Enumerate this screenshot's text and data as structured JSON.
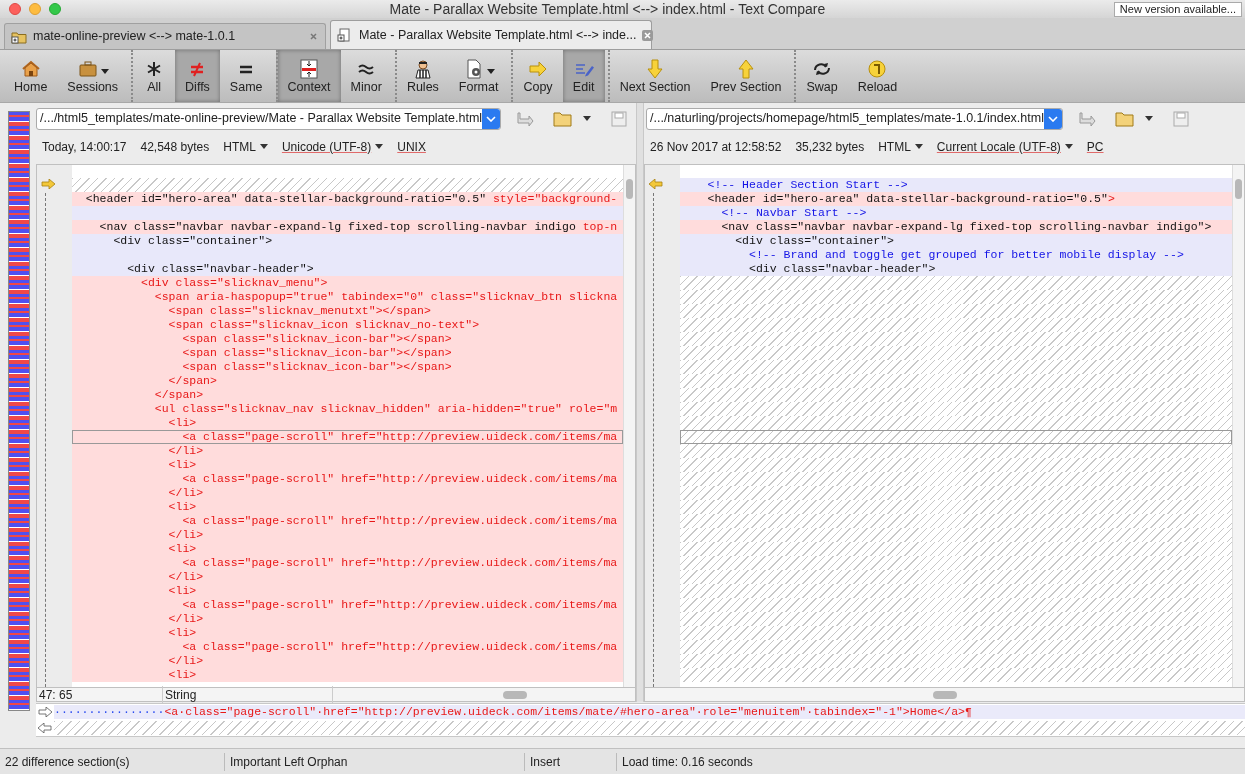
{
  "window": {
    "title": "Mate - Parallax Website Template.html <--> index.html - Text Compare",
    "notice_button": "New version available..."
  },
  "tabs": [
    {
      "label": "mate-online-preview <--> mate-1.0.1",
      "selected": false
    },
    {
      "label": "Mate - Parallax Website Template.html <--> inde...",
      "selected": true
    }
  ],
  "toolbar": [
    {
      "label": "Home",
      "pressed": false,
      "dropdown": false,
      "separator_before": false
    },
    {
      "label": "Sessions",
      "pressed": false,
      "dropdown": true,
      "separator_before": false
    },
    {
      "label": "All",
      "pressed": false,
      "dropdown": false,
      "separator_before": true
    },
    {
      "label": "Diffs",
      "pressed": true,
      "dropdown": false,
      "separator_before": false
    },
    {
      "label": "Same",
      "pressed": false,
      "dropdown": false,
      "separator_before": false
    },
    {
      "label": "Context",
      "pressed": true,
      "dropdown": false,
      "separator_before": true
    },
    {
      "label": "Minor",
      "pressed": false,
      "dropdown": false,
      "separator_before": false
    },
    {
      "label": "Rules",
      "pressed": false,
      "dropdown": false,
      "separator_before": true
    },
    {
      "label": "Format",
      "pressed": false,
      "dropdown": true,
      "separator_before": false
    },
    {
      "label": "Copy",
      "pressed": false,
      "dropdown": false,
      "separator_before": true
    },
    {
      "label": "Edit",
      "pressed": true,
      "dropdown": false,
      "separator_before": false
    },
    {
      "label": "Next Section",
      "pressed": false,
      "dropdown": false,
      "separator_before": true
    },
    {
      "label": "Prev Section",
      "pressed": false,
      "dropdown": false,
      "separator_before": false
    },
    {
      "label": "Swap",
      "pressed": false,
      "dropdown": false,
      "separator_before": true
    },
    {
      "label": "Reload",
      "pressed": false,
      "dropdown": false,
      "separator_before": false
    }
  ],
  "panes": [
    {
      "path": "/.../html5_templates/mate-online-preview/Mate - Parallax Website Template.html",
      "modified": "Today, 14:00:17",
      "size": "42,548 bytes",
      "format": "HTML",
      "encoding": "Unicode (UTF-8)",
      "line_endings": "UNIX",
      "cursor": "47: 65",
      "token": "String",
      "lines": [
        {
          "kind": "gap",
          "current": false
        },
        {
          "kind": "diff",
          "current": false,
          "parts": [
            {
              "text": "  <header id=\"hero-area\" data-stellar-background-ratio=\"0.5\" ",
              "kind": "plain"
            },
            {
              "text": "style=\"background-",
              "kind": "changed"
            }
          ]
        },
        {
          "kind": "same",
          "current": false
        },
        {
          "kind": "diff",
          "current": false,
          "parts": [
            {
              "text": "    <nav class=\"navbar navbar-expand-lg fixed-top scrolling-navbar indigo ",
              "kind": "plain"
            },
            {
              "text": "top-n",
              "kind": "changed"
            }
          ]
        },
        {
          "kind": "same",
          "current": false,
          "parts": [
            {
              "text": "      <div class=\"container\">",
              "kind": "plain"
            }
          ]
        },
        {
          "kind": "same",
          "current": false
        },
        {
          "kind": "same",
          "current": false,
          "parts": [
            {
              "text": "        <div class=\"navbar-header\">",
              "kind": "plain"
            }
          ]
        },
        {
          "kind": "diff",
          "current": false,
          "parts": [
            {
              "text": "          <div class=\"slicknav_menu\">",
              "kind": "changed"
            }
          ]
        },
        {
          "kind": "diff",
          "current": false,
          "parts": [
            {
              "text": "            <span aria-haspopup=\"true\" tabindex=\"0\" class=\"slicknav_btn slickna",
              "kind": "changed"
            }
          ]
        },
        {
          "kind": "diff",
          "current": false,
          "parts": [
            {
              "text": "              <span class=\"slicknav_menutxt\"></span>",
              "kind": "changed"
            }
          ]
        },
        {
          "kind": "diff",
          "current": false,
          "parts": [
            {
              "text": "              <span class=\"slicknav_icon slicknav_no-text\">",
              "kind": "changed"
            }
          ]
        },
        {
          "kind": "diff",
          "current": false,
          "parts": [
            {
              "text": "                <span class=\"slicknav_icon-bar\"></span>",
              "kind": "changed"
            }
          ]
        },
        {
          "kind": "diff",
          "current": false,
          "parts": [
            {
              "text": "                <span class=\"slicknav_icon-bar\"></span>",
              "kind": "changed"
            }
          ]
        },
        {
          "kind": "diff",
          "current": false,
          "parts": [
            {
              "text": "                <span class=\"slicknav_icon-bar\"></span>",
              "kind": "changed"
            }
          ]
        },
        {
          "kind": "diff",
          "current": false,
          "parts": [
            {
              "text": "              </span>",
              "kind": "changed"
            }
          ]
        },
        {
          "kind": "diff",
          "current": false,
          "parts": [
            {
              "text": "            </span>",
              "kind": "changed"
            }
          ]
        },
        {
          "kind": "diff",
          "current": false,
          "parts": [
            {
              "text": "            <ul class=\"slicknav_nav slicknav_hidden\" aria-hidden=\"true\" role=\"m",
              "kind": "changed"
            }
          ]
        },
        {
          "kind": "diff",
          "current": false,
          "parts": [
            {
              "text": "              <li>",
              "kind": "changed"
            }
          ]
        },
        {
          "kind": "diff",
          "current": true,
          "parts": [
            {
              "text": "                <a class=\"page-scroll\" href=\"http://preview.uideck.com/items/ma",
              "kind": "changed"
            }
          ]
        },
        {
          "kind": "diff",
          "current": false,
          "parts": [
            {
              "text": "              </li>",
              "kind": "changed"
            }
          ]
        },
        {
          "kind": "diff",
          "current": false,
          "parts": [
            {
              "text": "              <li>",
              "kind": "changed"
            }
          ]
        },
        {
          "kind": "diff",
          "current": false,
          "parts": [
            {
              "text": "                <a class=\"page-scroll\" href=\"http://preview.uideck.com/items/ma",
              "kind": "changed"
            }
          ]
        },
        {
          "kind": "diff",
          "current": false,
          "parts": [
            {
              "text": "              </li>",
              "kind": "changed"
            }
          ]
        },
        {
          "kind": "diff",
          "current": false,
          "parts": [
            {
              "text": "              <li>",
              "kind": "changed"
            }
          ]
        },
        {
          "kind": "diff",
          "current": false,
          "parts": [
            {
              "text": "                <a class=\"page-scroll\" href=\"http://preview.uideck.com/items/ma",
              "kind": "changed"
            }
          ]
        },
        {
          "kind": "diff",
          "current": false,
          "parts": [
            {
              "text": "              </li>",
              "kind": "changed"
            }
          ]
        },
        {
          "kind": "diff",
          "current": false,
          "parts": [
            {
              "text": "              <li>",
              "kind": "changed"
            }
          ]
        },
        {
          "kind": "diff",
          "current": false,
          "parts": [
            {
              "text": "                <a class=\"page-scroll\" href=\"http://preview.uideck.com/items/ma",
              "kind": "changed"
            }
          ]
        },
        {
          "kind": "diff",
          "current": false,
          "parts": [
            {
              "text": "              </li>",
              "kind": "changed"
            }
          ]
        },
        {
          "kind": "diff",
          "current": false,
          "parts": [
            {
              "text": "              <li>",
              "kind": "changed"
            }
          ]
        },
        {
          "kind": "diff",
          "current": false,
          "parts": [
            {
              "text": "                <a class=\"page-scroll\" href=\"http://preview.uideck.com/items/ma",
              "kind": "changed"
            }
          ]
        },
        {
          "kind": "diff",
          "current": false,
          "parts": [
            {
              "text": "              </li>",
              "kind": "changed"
            }
          ]
        },
        {
          "kind": "diff",
          "current": false,
          "parts": [
            {
              "text": "              <li>",
              "kind": "changed"
            }
          ]
        },
        {
          "kind": "diff",
          "current": false,
          "parts": [
            {
              "text": "                <a class=\"page-scroll\" href=\"http://preview.uideck.com/items/ma",
              "kind": "changed"
            }
          ]
        },
        {
          "kind": "diff",
          "current": false,
          "parts": [
            {
              "text": "              </li>",
              "kind": "changed"
            }
          ]
        },
        {
          "kind": "diff",
          "current": false,
          "parts": [
            {
              "text": "              <li>",
              "kind": "changed"
            }
          ]
        }
      ]
    },
    {
      "path": "/.../naturling/projects/homepage/html5_templates/mate-1.0.1/index.html",
      "modified": "26 Nov 2017 at 12:58:52",
      "size": "35,232 bytes",
      "format": "HTML",
      "encoding": "Current Locale (UTF-8)",
      "line_endings": "PC",
      "lines": [
        {
          "kind": "same",
          "current": false,
          "parts": [
            {
              "text": "    <!-- Header Section Start -->",
              "kind": "comment"
            }
          ]
        },
        {
          "kind": "diff",
          "current": false,
          "parts": [
            {
              "text": "    <header id=\"hero-area\" data-stellar-background-ratio=\"0.5\"",
              "kind": "plain"
            },
            {
              "text": ">",
              "kind": "changed"
            }
          ]
        },
        {
          "kind": "same",
          "current": false,
          "parts": [
            {
              "text": "      <!-- Navbar Start -->",
              "kind": "comment"
            }
          ]
        },
        {
          "kind": "diff",
          "current": false,
          "parts": [
            {
              "text": "      <nav class=\"navbar navbar-expand-lg fixed-top scrolling-navbar indigo\">",
              "kind": "plain"
            }
          ]
        },
        {
          "kind": "same",
          "current": false,
          "parts": [
            {
              "text": "        <div class=\"container\">",
              "kind": "plain"
            }
          ]
        },
        {
          "kind": "same",
          "current": false,
          "parts": [
            {
              "text": "          <!-- Brand and toggle get grouped for better mobile display -->",
              "kind": "comment"
            }
          ]
        },
        {
          "kind": "same",
          "current": false,
          "parts": [
            {
              "text": "          <div class=\"navbar-header\">",
              "kind": "plain"
            }
          ]
        },
        {
          "kind": "gap",
          "current": false
        },
        {
          "kind": "gap",
          "current": false
        },
        {
          "kind": "gap",
          "current": false
        },
        {
          "kind": "gap",
          "current": false
        },
        {
          "kind": "gap",
          "current": false
        },
        {
          "kind": "gap",
          "current": false
        },
        {
          "kind": "gap",
          "current": false
        },
        {
          "kind": "gap",
          "current": false
        },
        {
          "kind": "gap",
          "current": false
        },
        {
          "kind": "gap",
          "current": false
        },
        {
          "kind": "gap",
          "current": false
        },
        {
          "kind": "gap",
          "current": true
        },
        {
          "kind": "gap",
          "current": false
        },
        {
          "kind": "gap",
          "current": false
        },
        {
          "kind": "gap",
          "current": false
        },
        {
          "kind": "gap",
          "current": false
        },
        {
          "kind": "gap",
          "current": false
        },
        {
          "kind": "gap",
          "current": false
        },
        {
          "kind": "gap",
          "current": false
        },
        {
          "kind": "gap",
          "current": false
        },
        {
          "kind": "gap",
          "current": false
        },
        {
          "kind": "gap",
          "current": false
        },
        {
          "kind": "gap",
          "current": false
        },
        {
          "kind": "gap",
          "current": false
        },
        {
          "kind": "gap",
          "current": false
        },
        {
          "kind": "gap",
          "current": false
        },
        {
          "kind": "gap",
          "current": false
        },
        {
          "kind": "gap",
          "current": false
        },
        {
          "kind": "gap",
          "current": false
        }
      ]
    }
  ],
  "line_compare": [
    {
      "kind": "text",
      "parts": [
        {
          "text": "················",
          "kind": "space"
        },
        {
          "text": "<a·class=\"page-scroll\"·href=\"http://preview.uideck.com/items/mate/#hero-area\"·role=\"menuitem\"·tabindex=\"-1\">Home</a>¶",
          "kind": "changed"
        }
      ]
    },
    {
      "kind": "gap"
    }
  ],
  "status_bar": [
    "22 difference section(s)",
    "Important Left Orphan",
    "Insert",
    "Load time: 0.16 seconds"
  ]
}
